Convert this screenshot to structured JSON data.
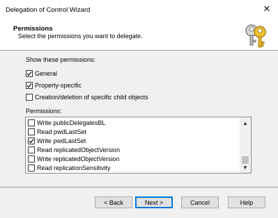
{
  "window": {
    "title": "Delegation of Control Wizard"
  },
  "header": {
    "title": "Permissions",
    "subtitle": "Select the permissions you want to delegate."
  },
  "show_permissions": {
    "label": "Show these permissions:",
    "options": [
      {
        "label": "General",
        "checked": true
      },
      {
        "label": "Property-specific",
        "checked": true
      },
      {
        "label": "Creation/deletion of specific child objects",
        "checked": false
      }
    ]
  },
  "permissions": {
    "label": "Permissions:",
    "items": [
      {
        "label": "Write publicDelegatesBL",
        "checked": false
      },
      {
        "label": "Read pwdLastSet",
        "checked": false
      },
      {
        "label": "Write pwdLastSet",
        "checked": true
      },
      {
        "label": "Read replicatedObjectVersion",
        "checked": false
      },
      {
        "label": "Write replicatedObjectVersion",
        "checked": false
      },
      {
        "label": "Read replicationSensitivity",
        "checked": false
      }
    ]
  },
  "buttons": {
    "back": "< Back",
    "next": "Next >",
    "cancel": "Cancel",
    "help": "Help"
  },
  "icons": {
    "close": "close-icon",
    "keys": "keys-icon",
    "scroll_up": "chevron-up-icon",
    "scroll_down": "chevron-down-icon"
  }
}
